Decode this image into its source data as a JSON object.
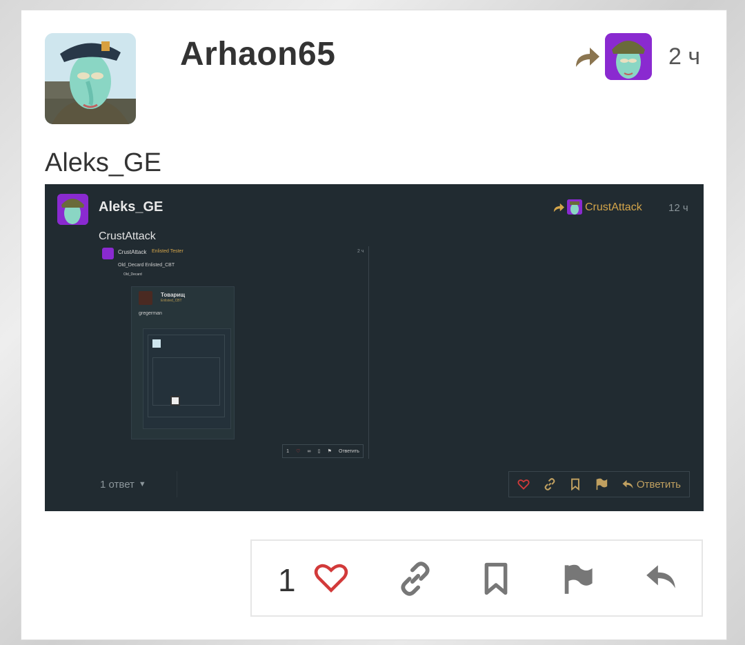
{
  "post": {
    "username": "Arhaon65",
    "time": "2 ч",
    "reply_to": "Aleks_GE",
    "like_count": "1"
  },
  "embed": {
    "username": "Aleks_GE",
    "repost_name": "CrustAttack",
    "time": "12 ч",
    "reply_to": "CrustAttack",
    "replies_label": "1 ответ",
    "reply_label": "Ответить",
    "nested": {
      "name": "CrustAttack",
      "rank": "Enlisted Tester",
      "time": "2 ч",
      "line1": "Old_Decard Enlisted_CBT",
      "line2": "Old_Decard",
      "line3": "Товарищ",
      "deep_name": "Товарищ",
      "deep_rank": "Enlisted_CBT",
      "deep_reply": "gregerman",
      "actions_count": "1",
      "actions_reply": "Ответить"
    }
  },
  "colors": {
    "heart": "#d23a3a",
    "icon_gray": "#777777",
    "gold": "#d4a54a",
    "embed_bg": "#212b31"
  },
  "icons": [
    "share-icon",
    "heart-icon",
    "link-icon",
    "bookmark-icon",
    "flag-icon",
    "reply-icon"
  ]
}
